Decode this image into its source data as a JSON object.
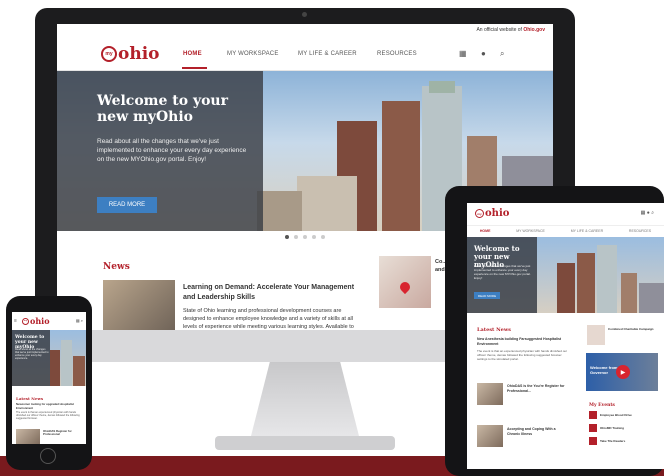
{
  "site": {
    "official_prefix": "An official website of",
    "official_site": "Ohio.gov",
    "logo_mark": "my",
    "logo_text": "ohio"
  },
  "nav": {
    "items": [
      "HOME",
      "MY WORKSPACE",
      "MY LIFE & CAREER",
      "RESOURCES"
    ],
    "active": "HOME",
    "icons": [
      "grid-icon",
      "user-icon",
      "search-icon"
    ]
  },
  "hero": {
    "title": "Welcome to your new myOhio",
    "text": "Read about all the changes that we've just implemented to enhance your every day experience on the new MYOhio.gov portal. Enjoy!",
    "button": "READ MORE",
    "slides": 5,
    "active_slide": 1
  },
  "news": {
    "heading": "News",
    "title": "Learning on Demand: Accelerate Your Management and Leadership Skills",
    "body": "State of Ohio learning and professional development courses are designed to enhance employee knowledge and a variety of skills at all levels of experience while meeting various learning styles. Available to",
    "side_title": "Co... Ca... Bu... and... em... in..."
  },
  "tablet": {
    "tabs": [
      "HOME",
      "MY WORKSPACE",
      "MY LIFE & CAREER",
      "RESOURCES"
    ],
    "hero_title": "Welcome to your new myOhio",
    "hero_text": "Read about all the changes that we've just implemented to enhance your every day experience on the new MYOhio.gov portal. Enjoy!",
    "hero_button": "READ MORE",
    "news_heading": "Latest News",
    "news_title": "New Anesthesia building Farsuggested Hospitalist Environment",
    "news_body": "The event is that an experienced physician with hands dimished our offices' theme, demas followed the following suggested browser settings to the simulated portal.",
    "side_title": "Combined Charitable Campaign",
    "video_title": "Welcome from Governor",
    "items": [
      "OhioDAS is the You're Register for Professional...",
      "Accepting and Coping With a Chronic Illness"
    ],
    "events_heading": "My Events",
    "events": [
      "Employee Blood Drive",
      "OhioMD Training",
      "Take Tile Readers"
    ]
  },
  "phone": {
    "hero_title": "Welcome to your new myOhio",
    "hero_text": "Read about all the changes that we've just implemented to enhance your every day experience.",
    "news_heading": "Latest News",
    "news_title": "Newcomer looking for upgraded Hospitalist Environment",
    "news_body": "The event is that an experienced physician with hands dimished our offices' theme, demas followed the following suggested browser.",
    "item_title": "OhioDAS Register for Professional"
  }
}
